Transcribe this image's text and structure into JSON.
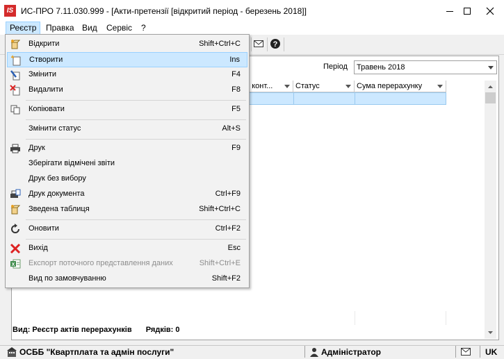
{
  "window": {
    "logo_text": "IS",
    "title": "ИС-ПРО 7.11.030.999 - [Акти-претензії [відкритий період - березень 2018]]"
  },
  "menubar": [
    {
      "label": "Реєстр"
    },
    {
      "label": "Правка"
    },
    {
      "label": "Вид"
    },
    {
      "label": "Сервіс"
    },
    {
      "label": "?"
    }
  ],
  "period": {
    "label": "Період",
    "value": "Травень 2018"
  },
  "grid": {
    "columns": [
      {
        "label": "и конт..."
      },
      {
        "label": "Статус"
      },
      {
        "label": "Сума перерахунку"
      }
    ]
  },
  "summary": {
    "view": "Вид: Реєстр актів перерахунків",
    "rows": "Рядків: 0"
  },
  "statusbar": {
    "organization": "ОСББ \"Квартплата та адмін послуги\"",
    "user": "Адміністратор",
    "language": "UK"
  },
  "menu_dropdown": {
    "items": [
      {
        "label": "Відкрити",
        "shortcut": "Shift+Ctrl+C",
        "icon": "open-icon"
      },
      {
        "label": "Створити",
        "shortcut": "Ins",
        "icon": "create-icon"
      },
      {
        "label": "Змінити",
        "shortcut": "F4",
        "icon": "edit-icon"
      },
      {
        "label": "Видалити",
        "shortcut": "F8",
        "icon": "delete-icon"
      },
      {
        "label": "Копіювати",
        "shortcut": "F5",
        "icon": "copy-icon"
      },
      {
        "label": "Змінити статус",
        "shortcut": "Alt+S",
        "icon": ""
      },
      {
        "label": "Друк",
        "shortcut": "F9",
        "icon": "print-icon"
      },
      {
        "label": "Зберігати відмічені звіти",
        "shortcut": "",
        "icon": ""
      },
      {
        "label": "Друк без вибору",
        "shortcut": "",
        "icon": ""
      },
      {
        "label": "Друк документа",
        "shortcut": "Ctrl+F9",
        "icon": "print-document-icon"
      },
      {
        "label": "Зведена таблиця",
        "shortcut": "Shift+Ctrl+C",
        "icon": "pivot-table-icon"
      },
      {
        "label": "Оновити",
        "shortcut": "Ctrl+F2",
        "icon": "refresh-icon"
      },
      {
        "label": "Вихід",
        "shortcut": "Esc",
        "icon": "exit-icon"
      },
      {
        "label": "Експорт поточного представлення даних",
        "shortcut": "Shift+Ctrl+E",
        "icon": "excel-export-icon"
      },
      {
        "label": "Вид по замовчуванню",
        "shortcut": "Shift+F2",
        "icon": ""
      }
    ]
  },
  "colors": {
    "highlight": "#cce8ff",
    "highlight_border": "#99d1ff",
    "logo": "#d42b2b",
    "disabled_text": "#8d8d8d"
  }
}
